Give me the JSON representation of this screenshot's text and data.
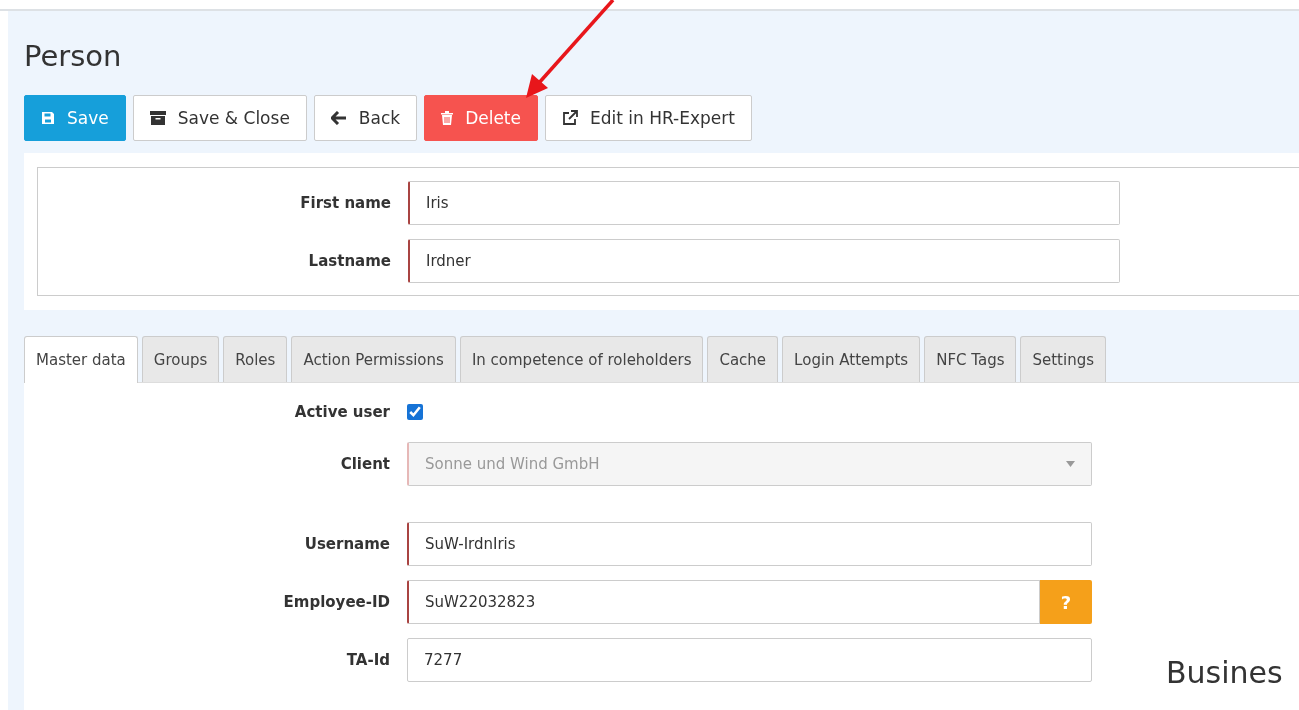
{
  "page": {
    "title": "Person"
  },
  "toolbar": [
    {
      "label": "Save",
      "kind": "primary"
    },
    {
      "label": "Save & Close",
      "kind": "default"
    },
    {
      "label": "Back",
      "kind": "default"
    },
    {
      "label": "Delete",
      "kind": "danger"
    },
    {
      "label": "Edit in HR-Expert",
      "kind": "default"
    }
  ],
  "header_fields": [
    {
      "label": "First name",
      "value": "Iris",
      "required": true
    },
    {
      "label": "Lastname",
      "value": "Irdner",
      "required": true
    }
  ],
  "tabs": [
    {
      "label": "Master data",
      "selected": true
    },
    {
      "label": "Groups",
      "selected": false
    },
    {
      "label": "Roles",
      "selected": false
    },
    {
      "label": "Action Permissions",
      "selected": false
    },
    {
      "label": "In competence of roleholders",
      "selected": false
    },
    {
      "label": "Cache",
      "selected": false
    },
    {
      "label": "Login Attempts",
      "selected": false
    },
    {
      "label": "NFC Tags",
      "selected": false
    },
    {
      "label": "Settings",
      "selected": false
    }
  ],
  "master_data": [
    {
      "kind": "checkbox",
      "label": "Active user",
      "checked": true
    },
    {
      "kind": "select",
      "label": "Client",
      "value": "Sonne und Wind GmbH",
      "required": true,
      "disabled": true
    },
    {
      "kind": "text",
      "label": "Username",
      "value": "SuW-IrdnIris",
      "required": true
    },
    {
      "kind": "addon",
      "label": "Employee-ID",
      "value": "SuW22032823",
      "required": true,
      "addon": "?"
    },
    {
      "kind": "text",
      "label": "TA-Id",
      "value": "7277",
      "required": false
    }
  ],
  "side_heading": "Busines"
}
